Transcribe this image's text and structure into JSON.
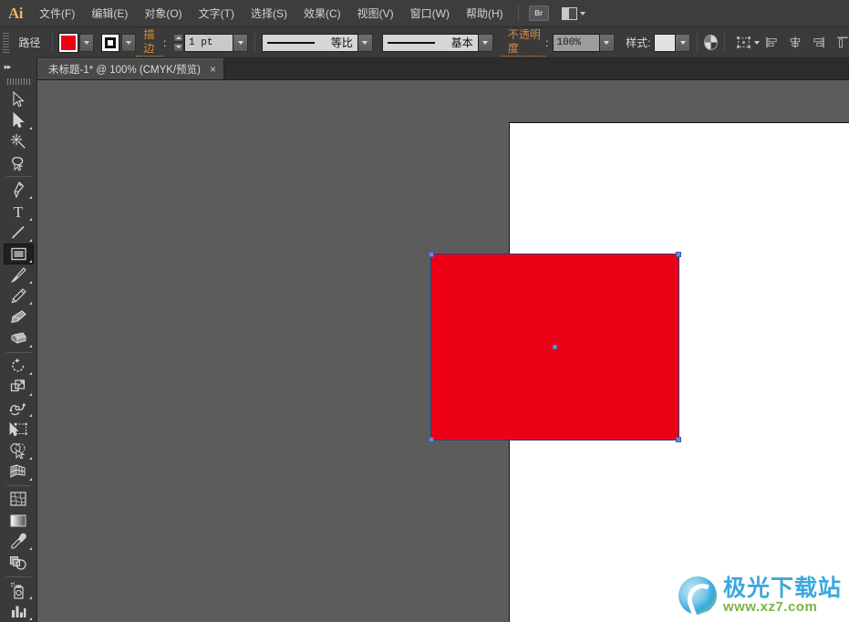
{
  "app": {
    "name": "Adobe Illustrator",
    "logo_text": "Ai"
  },
  "menubar": {
    "items": [
      {
        "label": "文件(F)",
        "accel": "F"
      },
      {
        "label": "编辑(E)",
        "accel": "E"
      },
      {
        "label": "对象(O)",
        "accel": "O"
      },
      {
        "label": "文字(T)",
        "accel": "T"
      },
      {
        "label": "选择(S)",
        "accel": "S"
      },
      {
        "label": "效果(C)",
        "accel": "C"
      },
      {
        "label": "视图(V)",
        "accel": "V"
      },
      {
        "label": "窗口(W)",
        "accel": "W"
      },
      {
        "label": "帮助(H)",
        "accel": "H"
      }
    ],
    "bridge_button_label": "Br",
    "arrange_documents_icon": "arrange-documents-icon"
  },
  "controlbar": {
    "selection_type_label": "路径",
    "fill_color": "#ec0016",
    "fill_swatch_name": "fill-swatch",
    "stroke_swatch_name": "stroke-swatch",
    "stroke_label": "描边",
    "stroke_colon": ":",
    "stroke_weight_value": "1 pt",
    "variable_width_profile": "等比",
    "brush_definition": "基本",
    "opacity_label": "不透明度",
    "opacity_colon": ":",
    "opacity_value": "100%",
    "style_label": "样式",
    "style_colon": ":",
    "recolor_artwork_icon": "recolor-artwork-icon",
    "transform_icon": "transform-panel-icon",
    "align_left_icon": "align-left-icon",
    "align_center_icon": "align-center-horizontal-icon",
    "align_right_icon": "align-right-icon",
    "align_top_icon": "align-top-icon"
  },
  "tabbar": {
    "document_title": "未标题-1* @ 100% (CMYK/预览)",
    "close_glyph": "×"
  },
  "toolbar": {
    "expand_glyph": "▸▸",
    "tools": [
      {
        "name": "selection-tool",
        "label": "选择工具",
        "selected": false,
        "has_flyout": false
      },
      {
        "name": "direct-selection-tool",
        "label": "直接选择工具",
        "selected": false,
        "has_flyout": true
      },
      {
        "name": "magic-wand-tool",
        "label": "魔棒工具",
        "selected": false,
        "has_flyout": false
      },
      {
        "name": "lasso-tool",
        "label": "套索工具",
        "selected": false,
        "has_flyout": false
      },
      {
        "name": "divider",
        "label": "",
        "selected": false,
        "has_flyout": false
      },
      {
        "name": "pen-tool",
        "label": "钢笔工具",
        "selected": false,
        "has_flyout": true
      },
      {
        "name": "type-tool",
        "label": "文字工具",
        "selected": false,
        "has_flyout": true
      },
      {
        "name": "line-segment-tool",
        "label": "直线段工具",
        "selected": false,
        "has_flyout": true
      },
      {
        "name": "rectangle-tool",
        "label": "矩形工具",
        "selected": true,
        "has_flyout": true
      },
      {
        "name": "paintbrush-tool",
        "label": "画笔工具",
        "selected": false,
        "has_flyout": true
      },
      {
        "name": "pencil-tool",
        "label": "铅笔工具",
        "selected": false,
        "has_flyout": true
      },
      {
        "name": "blob-brush-tool",
        "label": "斑点画笔工具",
        "selected": false,
        "has_flyout": false
      },
      {
        "name": "eraser-tool",
        "label": "橡皮擦工具",
        "selected": false,
        "has_flyout": true
      },
      {
        "name": "divider",
        "label": "",
        "selected": false,
        "has_flyout": false
      },
      {
        "name": "rotate-tool",
        "label": "旋转工具",
        "selected": false,
        "has_flyout": true
      },
      {
        "name": "scale-tool",
        "label": "比例缩放工具",
        "selected": false,
        "has_flyout": true
      },
      {
        "name": "width-tool",
        "label": "宽度工具",
        "selected": false,
        "has_flyout": true
      },
      {
        "name": "free-transform-tool",
        "label": "自由变换工具",
        "selected": false,
        "has_flyout": false
      },
      {
        "name": "shape-builder-tool",
        "label": "形状生成器工具",
        "selected": false,
        "has_flyout": true
      },
      {
        "name": "perspective-grid-tool",
        "label": "透视网格工具",
        "selected": false,
        "has_flyout": true
      },
      {
        "name": "divider",
        "label": "",
        "selected": false,
        "has_flyout": false
      },
      {
        "name": "mesh-tool",
        "label": "网格工具",
        "selected": false,
        "has_flyout": false
      },
      {
        "name": "gradient-tool",
        "label": "渐变工具",
        "selected": false,
        "has_flyout": false
      },
      {
        "name": "eyedropper-tool",
        "label": "吸管工具",
        "selected": false,
        "has_flyout": true
      },
      {
        "name": "blend-tool",
        "label": "混合工具",
        "selected": false,
        "has_flyout": false
      },
      {
        "name": "divider",
        "label": "",
        "selected": false,
        "has_flyout": false
      },
      {
        "name": "symbol-sprayer-tool",
        "label": "符号喷枪工具",
        "selected": false,
        "has_flyout": true
      },
      {
        "name": "column-graph-tool",
        "label": "柱形图工具",
        "selected": false,
        "has_flyout": true
      }
    ]
  },
  "canvas": {
    "background_color": "#5c5c5c",
    "artboard_color": "#ffffff",
    "zoom_level": "100%",
    "selected_object": {
      "type": "rectangle",
      "fill_color": "#ec0016",
      "stroke_color": "#2f3d7a",
      "selection_color": "#6d8ad6",
      "handles": 4
    }
  },
  "watermark": {
    "title": "极光下载站",
    "url": "www.xz7.com"
  }
}
